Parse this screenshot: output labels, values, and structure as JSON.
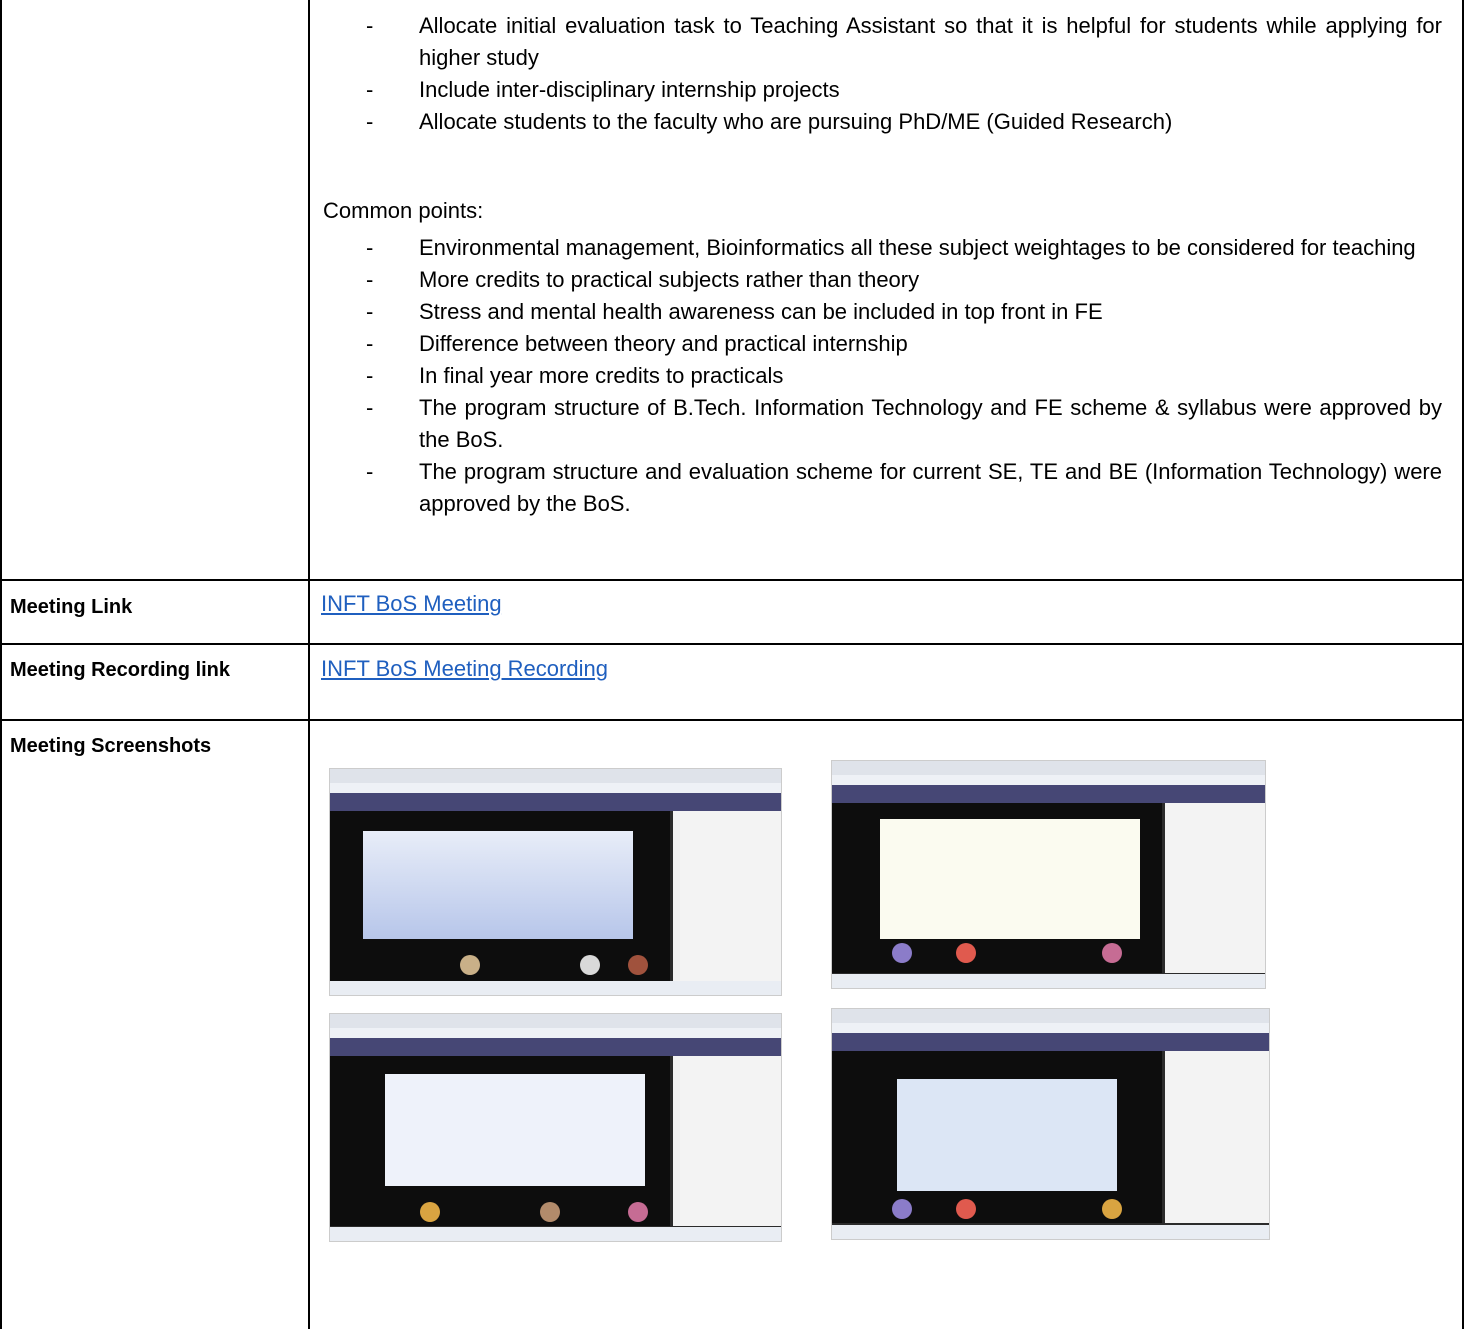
{
  "top_section": {
    "bullets_a": [
      "Allocate initial evaluation task to Teaching Assistant so that it is helpful for students while applying for higher study",
      "Include inter-disciplinary internship projects",
      "Allocate students to the faculty who are pursuing PhD/ME (Guided Research)"
    ],
    "common_heading": "Common points:",
    "bullets_b": [
      "Environmental management, Bioinformatics all these subject weightages to be considered for teaching",
      "More credits to practical subjects rather than theory",
      "Stress and mental health awareness can be included in top front in FE",
      "Difference between theory and practical internship",
      "In final year more credits to practicals",
      "The program structure of B.Tech. Information Technology and FE scheme & syllabus were approved by the BoS.",
      "The program structure and evaluation scheme for current SE, TE and BE (Information Technology) were approved by the BoS."
    ],
    "dash": "-"
  },
  "rows": {
    "meeting_link": {
      "label": "Meeting Link",
      "value": "INFT BoS Meeting"
    },
    "recording_link": {
      "label": "Meeting Recording link",
      "value": "INFT BoS Meeting Recording"
    },
    "screenshots": {
      "label": "Meeting Screenshots"
    }
  },
  "colors": {
    "link": "#1f5fbf",
    "border": "#000000"
  }
}
